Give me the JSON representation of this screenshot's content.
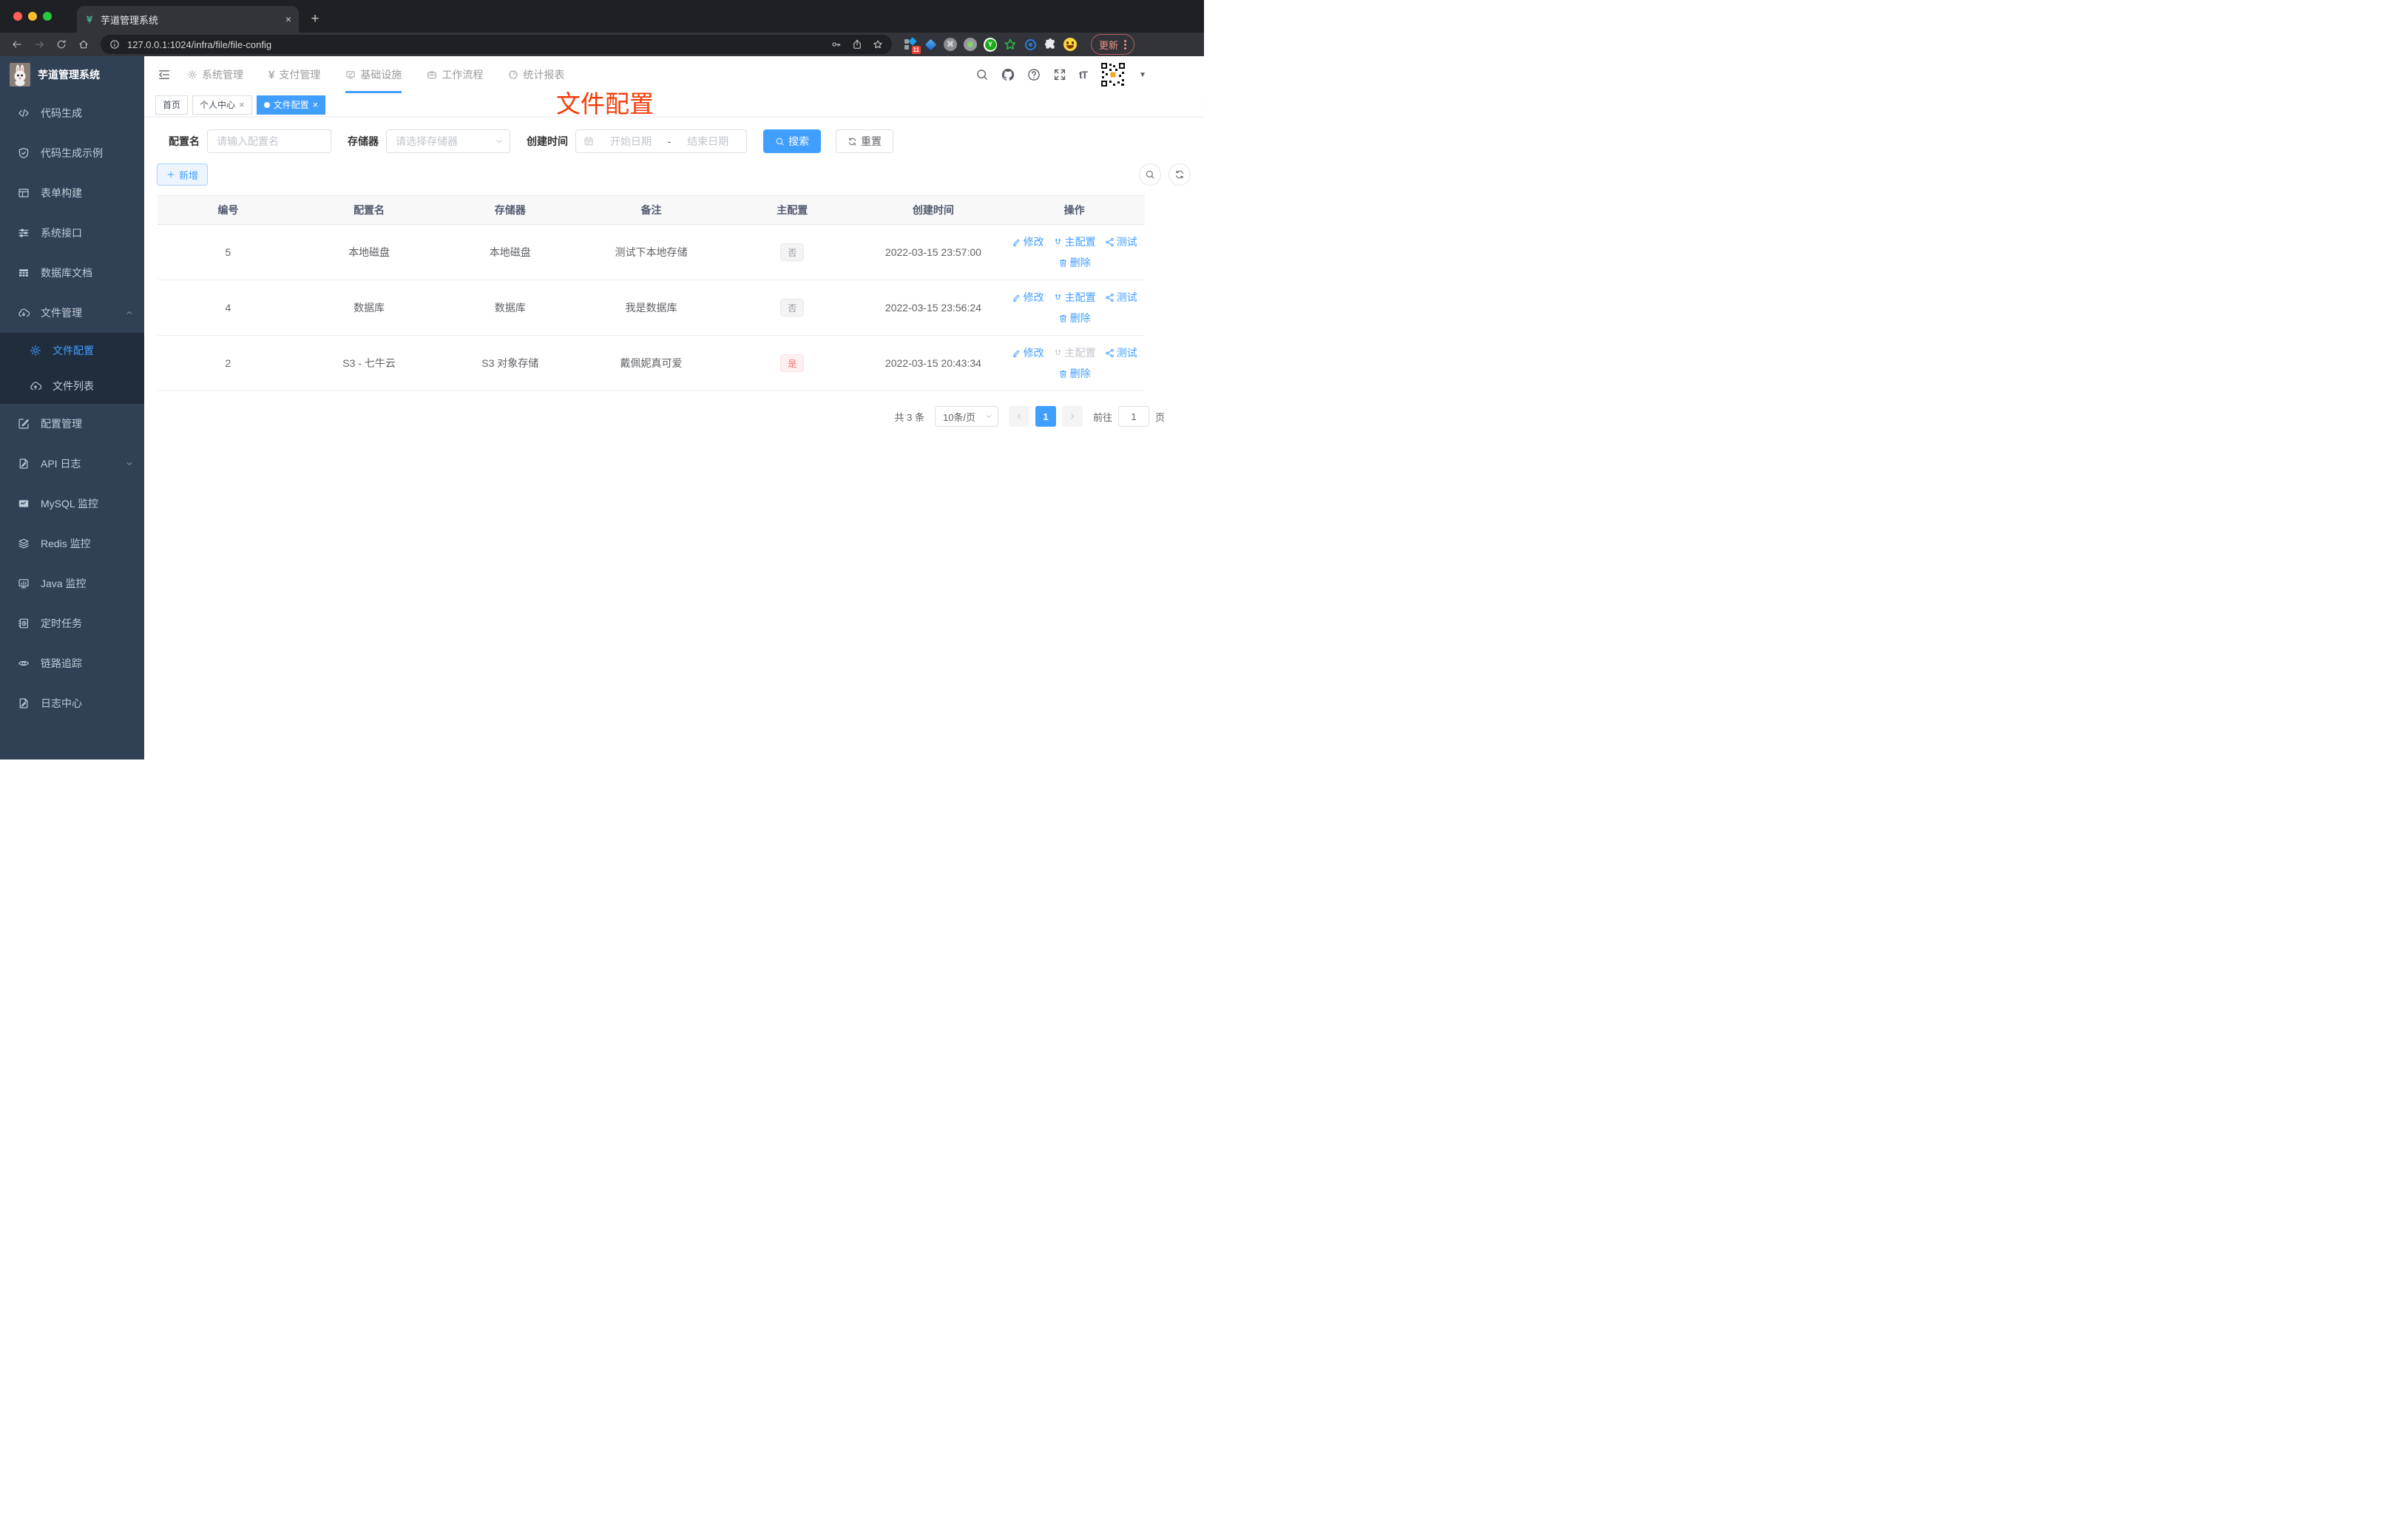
{
  "browser": {
    "tab_title": "芋道管理系统",
    "url": "127.0.0.1:1024/infra/file/file-config",
    "extensions_badge": "11",
    "ext_cmd_glyph": "⌘",
    "ext_y_glyph": "Y",
    "update_label": "更新"
  },
  "header": {
    "logo_title": "芋道管理系统",
    "yen_glyph": "¥",
    "font_size_glyph": "tT",
    "nav": [
      {
        "label": "系统管理",
        "icon": "gear-icon"
      },
      {
        "label": "支付管理",
        "icon": "yen-icon"
      },
      {
        "label": "基础设施",
        "icon": "monitor-check-icon",
        "active": true
      },
      {
        "label": "工作流程",
        "icon": "briefcase-icon"
      },
      {
        "label": "统计报表",
        "icon": "gauge-icon"
      }
    ]
  },
  "tags": [
    {
      "label": "首页",
      "closable": false,
      "active": false
    },
    {
      "label": "个人中心",
      "closable": true,
      "active": false
    },
    {
      "label": "文件配置",
      "closable": true,
      "active": true
    }
  ],
  "annotation": {
    "text": "文件配置",
    "color": "#f53a09"
  },
  "sidebar": {
    "items": [
      {
        "label": "代码生成",
        "icon": "code-icon"
      },
      {
        "label": "代码生成示例",
        "icon": "shield-check-icon"
      },
      {
        "label": "表单构建",
        "icon": "form-grid-icon"
      },
      {
        "label": "系统接口",
        "icon": "sliders-icon"
      },
      {
        "label": "数据库文档",
        "icon": "table-filled-icon"
      },
      {
        "label": "文件管理",
        "icon": "cloud-download-icon",
        "expanded": true
      },
      {
        "label": "文件配置",
        "icon": "gear-icon",
        "active": true,
        "sub": true
      },
      {
        "label": "文件列表",
        "icon": "cloud-upload-icon",
        "sub": true
      },
      {
        "label": "配置管理",
        "icon": "edit-square-icon"
      },
      {
        "label": "API 日志",
        "icon": "doc-pen-icon",
        "collapsible": true
      },
      {
        "label": "MySQL 监控",
        "icon": "chart-monitor-icon"
      },
      {
        "label": "Redis 监控",
        "icon": "layers-icon"
      },
      {
        "label": "Java 监控",
        "icon": "display-icon"
      },
      {
        "label": "定时任务",
        "icon": "timer-doc-icon"
      },
      {
        "label": "链路追踪",
        "icon": "eye-icon"
      },
      {
        "label": "日志中心",
        "icon": "doc-pen-icon"
      }
    ]
  },
  "filter": {
    "name_label": "配置名",
    "name_placeholder": "请输入配置名",
    "storage_label": "存储器",
    "storage_placeholder": "请选择存储器",
    "time_label": "创建时间",
    "start_placeholder": "开始日期",
    "separator": "-",
    "end_placeholder": "结束日期",
    "search_label": "搜索",
    "reset_label": "重置"
  },
  "toolbar": {
    "add_label": "新增"
  },
  "table": {
    "headers": [
      "编号",
      "配置名",
      "存储器",
      "备注",
      "主配置",
      "创建时间",
      "操作"
    ],
    "action_labels": {
      "edit": "修改",
      "master": "主配置",
      "test": "测试",
      "delete": "删除"
    },
    "rows": [
      {
        "id": "5",
        "name": "本地磁盘",
        "storage": "本地磁盘",
        "remark": "测试下本地存储",
        "master": "否",
        "master_type": "info",
        "created": "2022-03-15 23:57:00",
        "master_action_disabled": false
      },
      {
        "id": "4",
        "name": "数据库",
        "storage": "数据库",
        "remark": "我是数据库",
        "master": "否",
        "master_type": "info",
        "created": "2022-03-15 23:56:24",
        "master_action_disabled": false
      },
      {
        "id": "2",
        "name": "S3 - 七牛云",
        "storage": "S3 对象存储",
        "remark": "戴佩妮真可爱",
        "master": "是",
        "master_type": "danger",
        "created": "2022-03-15 20:43:34",
        "master_action_disabled": true
      }
    ]
  },
  "pagination": {
    "total": "共 3 条",
    "page_size": "10条/页",
    "current": "1",
    "goto_label": "前往",
    "goto_value": "1",
    "page_unit": "页"
  },
  "colors": {
    "accent": "#409eff",
    "sidebar_bg": "#304156",
    "submenu_bg": "#1f2d3d",
    "danger": "#f56c6c",
    "annotation_red": "#f53a09"
  }
}
